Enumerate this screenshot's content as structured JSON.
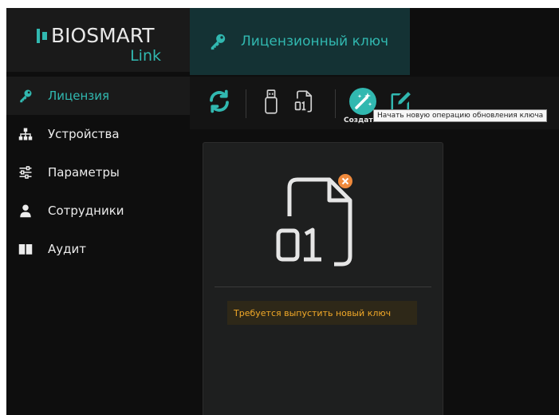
{
  "logo": {
    "title": "BIOSMART",
    "subtitle": "Link"
  },
  "sidebar": {
    "items": [
      {
        "label": "Лицензия",
        "icon": "key-icon",
        "active": true
      },
      {
        "label": "Устройства",
        "icon": "network-icon",
        "active": false
      },
      {
        "label": "Параметры",
        "icon": "sliders-icon",
        "active": false
      },
      {
        "label": "Сотрудники",
        "icon": "user-icon",
        "active": false
      },
      {
        "label": "Аудит",
        "icon": "book-icon",
        "active": false
      }
    ]
  },
  "tabs": [
    {
      "label": "Лицензионный ключ",
      "icon": "key-icon",
      "active": true
    }
  ],
  "toolbar": {
    "buttons": [
      {
        "icon": "refresh-icon"
      },
      {
        "icon": "usb-drive-icon"
      },
      {
        "icon": "binary-file-icon"
      },
      {
        "icon": "magic-wand-icon"
      },
      {
        "icon": "edit-icon"
      }
    ],
    "hover_caption": "Создать новый ключ",
    "tooltip": "Начать новую операцию обновления ключа"
  },
  "card": {
    "icon": "binary-file-icon",
    "file_label": "01",
    "badge": "x",
    "status": "Требуется выпустить новый ключ"
  },
  "colors": {
    "accent": "#31b8b0",
    "warning": "#f2a928",
    "badge": "#f08a3c"
  }
}
